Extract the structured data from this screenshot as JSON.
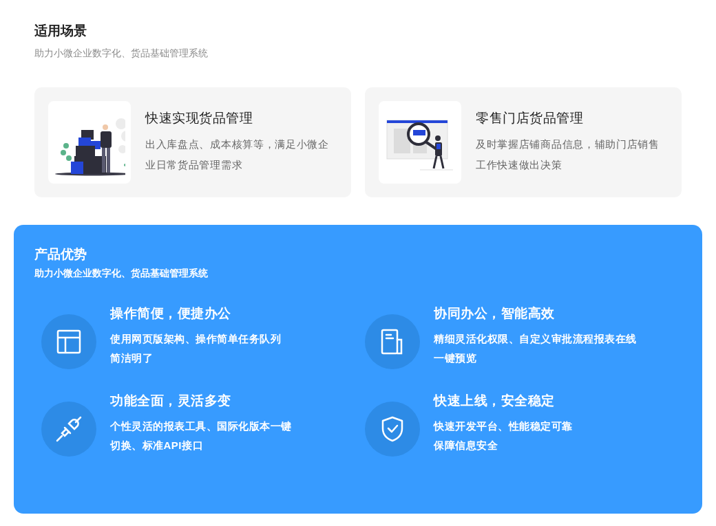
{
  "scenarios": {
    "title": "适用场景",
    "subtitle": "助力小微企业数字化、货品基础管理系统",
    "cards": [
      {
        "title": "快速实现货品管理",
        "description_lines": [
          "出入库盘点、成本核算等，满足小微企",
          "业日常货品管理需求"
        ]
      },
      {
        "title": "零售门店货品管理",
        "description_lines": [
          "及时掌握店铺商品信息，辅助门店销售",
          "工作快速做出决策"
        ]
      }
    ]
  },
  "advantages": {
    "title": "产品优势",
    "subtitle": "助力小微企业数字化、货品基础管理系统",
    "features": [
      {
        "title": "操作简便，便捷办公",
        "description_lines": [
          "使用网页版架构、操作简单任务队列",
          "简洁明了"
        ]
      },
      {
        "title": "协同办公，智能高效",
        "description_lines": [
          "精细灵活化权限、自定义审批流程报表在线",
          "一键预览"
        ]
      },
      {
        "title": "功能全面，灵活多变",
        "description_lines": [
          "个性灵活的报表工具、国际化版本一键",
          "切换、标准API接口"
        ]
      },
      {
        "title": "快速上线，安全稳定",
        "description_lines": [
          "快速开发平台、性能稳定可靠",
          "保障信息安全"
        ]
      }
    ]
  }
}
